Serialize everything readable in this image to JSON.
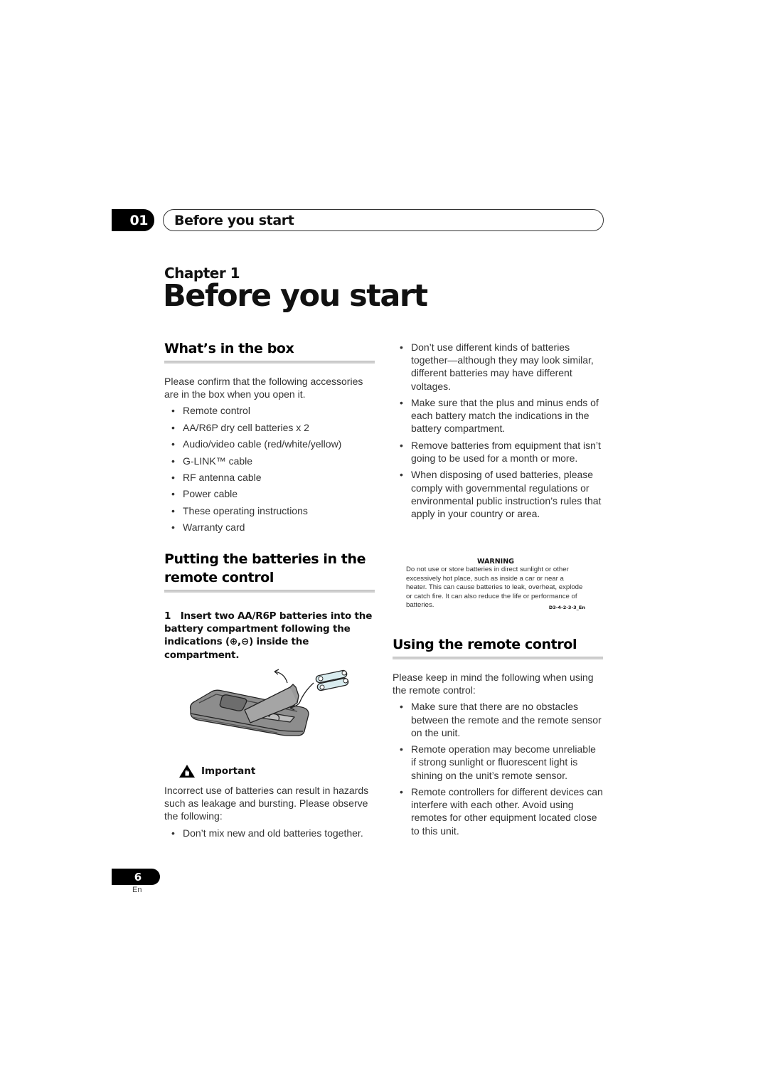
{
  "header": {
    "chapter_number": "01",
    "chapter_name": "Before you start"
  },
  "chapter": {
    "label": "Chapter 1",
    "title": "Before you start"
  },
  "whats_in_box": {
    "heading": "What’s in the box",
    "intro": "Please confirm that the following accessories are in the box when you open it.",
    "items": [
      "Remote control",
      "AA/R6P dry cell batteries x 2",
      "Audio/video cable (red/white/yellow)",
      "G-LINK™ cable",
      "RF antenna cable",
      "Power cable",
      "These operating instructions",
      "Warranty card"
    ]
  },
  "batteries": {
    "heading": "Putting the batteries in the remote control",
    "step_number": "1",
    "step_text": "Insert two AA/R6P batteries into the battery compartment following the indications (⊕,⊖) inside the compartment.",
    "illustration": "remote-battery-insertion-illustration",
    "important_label": "Important",
    "important_text": "Incorrect use of batteries can result in hazards such as leakage and bursting. Please observe the following:",
    "important_items": [
      "Don’t mix new and old batteries together.",
      "Don’t use different kinds of batteries together—although they may look similar, different batteries may have different voltages.",
      "Make sure that the plus and minus ends of each battery match the indications in the battery compartment.",
      "Remove batteries from equipment that isn’t going to be used for a month or more.",
      "When disposing of used batteries, please comply with governmental regulations or environmental public instruction’s rules that apply in your country or area."
    ],
    "warning": {
      "title": "WARNING",
      "text": "Do not use or store batteries in direct sunlight or other excessively hot place, such as inside a car or near a heater. This can cause batteries to leak, overheat, explode or catch fire. It can also reduce the life or performance of batteries.",
      "code": "D3-4-2-3-3_En"
    }
  },
  "using_remote": {
    "heading": "Using the remote control",
    "intro": "Please keep in mind the following when using the remote control:",
    "items": [
      "Make sure that there are no obstacles between the remote and the remote sensor on the unit.",
      "Remote operation may become unreliable if strong sunlight or fluorescent light is shining on the unit’s remote sensor.",
      "Remote controllers for different devices can interfere with each other. Avoid using remotes for other equipment located close to this unit."
    ]
  },
  "footer": {
    "page_number": "6",
    "language": "En"
  }
}
